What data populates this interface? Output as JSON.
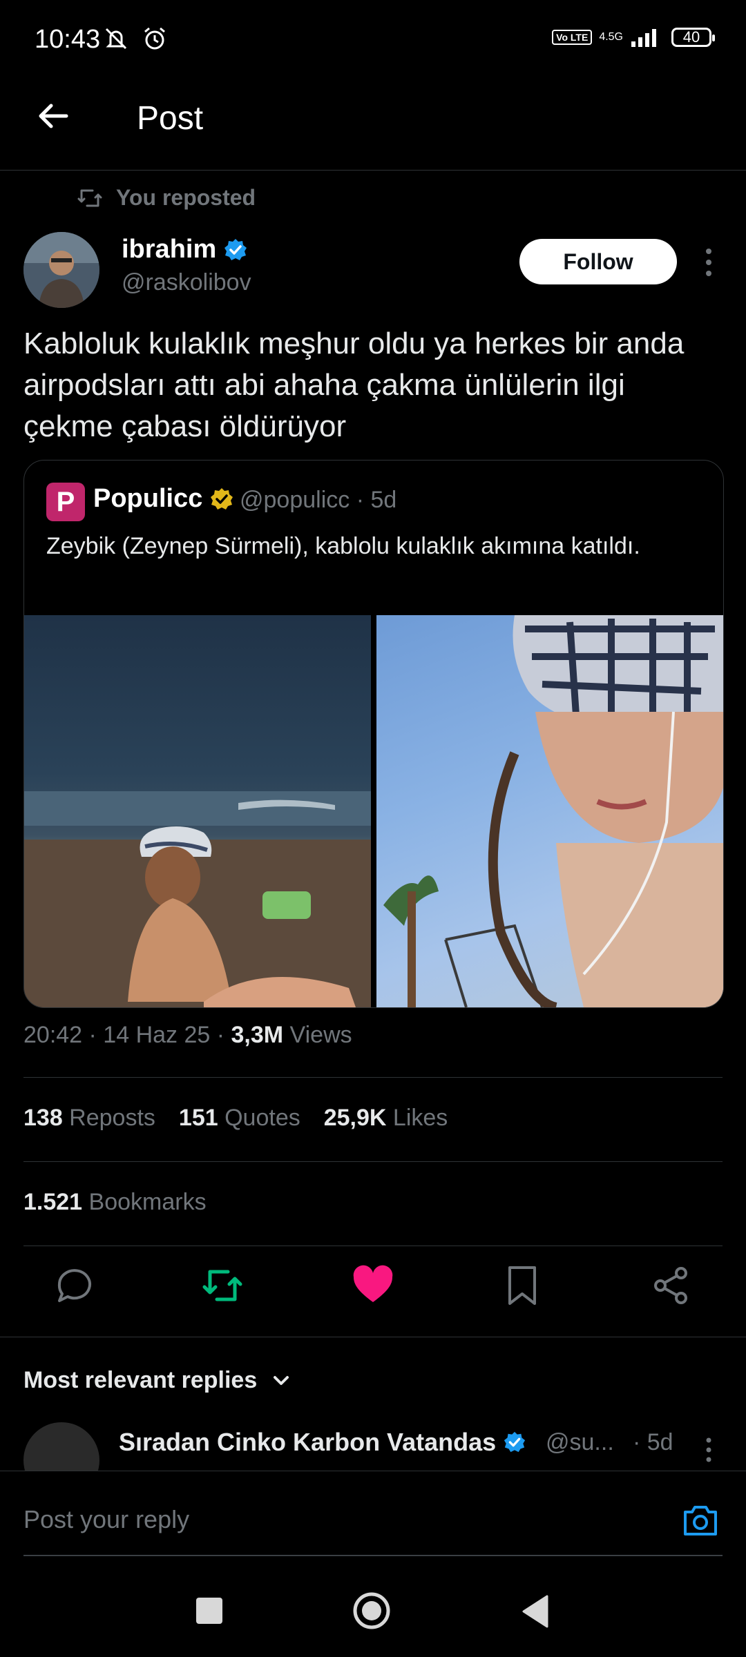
{
  "status_bar": {
    "time": "10:43",
    "network": "4.5G",
    "volte": "Vo LTE",
    "battery": "40"
  },
  "topbar": {
    "title": "Post"
  },
  "repost": {
    "label": "You reposted"
  },
  "author": {
    "name": "ibrahim",
    "handle": "@raskolibov",
    "follow_label": "Follow"
  },
  "post": {
    "text": "Kabloluk kulaklık meşhur oldu ya herkes bir anda airpodsları attı abi ahaha çakma ünlülerin ilgi çekme çabası öldürüyor"
  },
  "quote": {
    "logo_letter": "P",
    "name": "Populicc",
    "handle": "@populicc · 5d",
    "text": "Zeybik (Zeynep Sürmeli), kablolu kulaklık akımına katıldı."
  },
  "meta": {
    "time_date": "20:42 · 14 Haz 25 · ",
    "views_count": "3,3M",
    "views_label": " Views"
  },
  "stats": {
    "reposts_count": "138",
    "reposts_label": " Reposts",
    "quotes_count": "151",
    "quotes_label": " Quotes",
    "likes_count": "25,9K",
    "likes_label": " Likes",
    "bookmarks_count": "1.521",
    "bookmarks_label": " Bookmarks"
  },
  "replies": {
    "header": "Most relevant replies",
    "first": {
      "name": "Sıradan Cinko Karbon Vatandas",
      "handle": "@su...",
      "time": "· 5d"
    }
  },
  "compose": {
    "placeholder": "Post your reply"
  },
  "colors": {
    "accent": "#1d9bf0",
    "like": "#f91880",
    "repost": "#00ba7c",
    "gold_verified": "#e2b719"
  }
}
